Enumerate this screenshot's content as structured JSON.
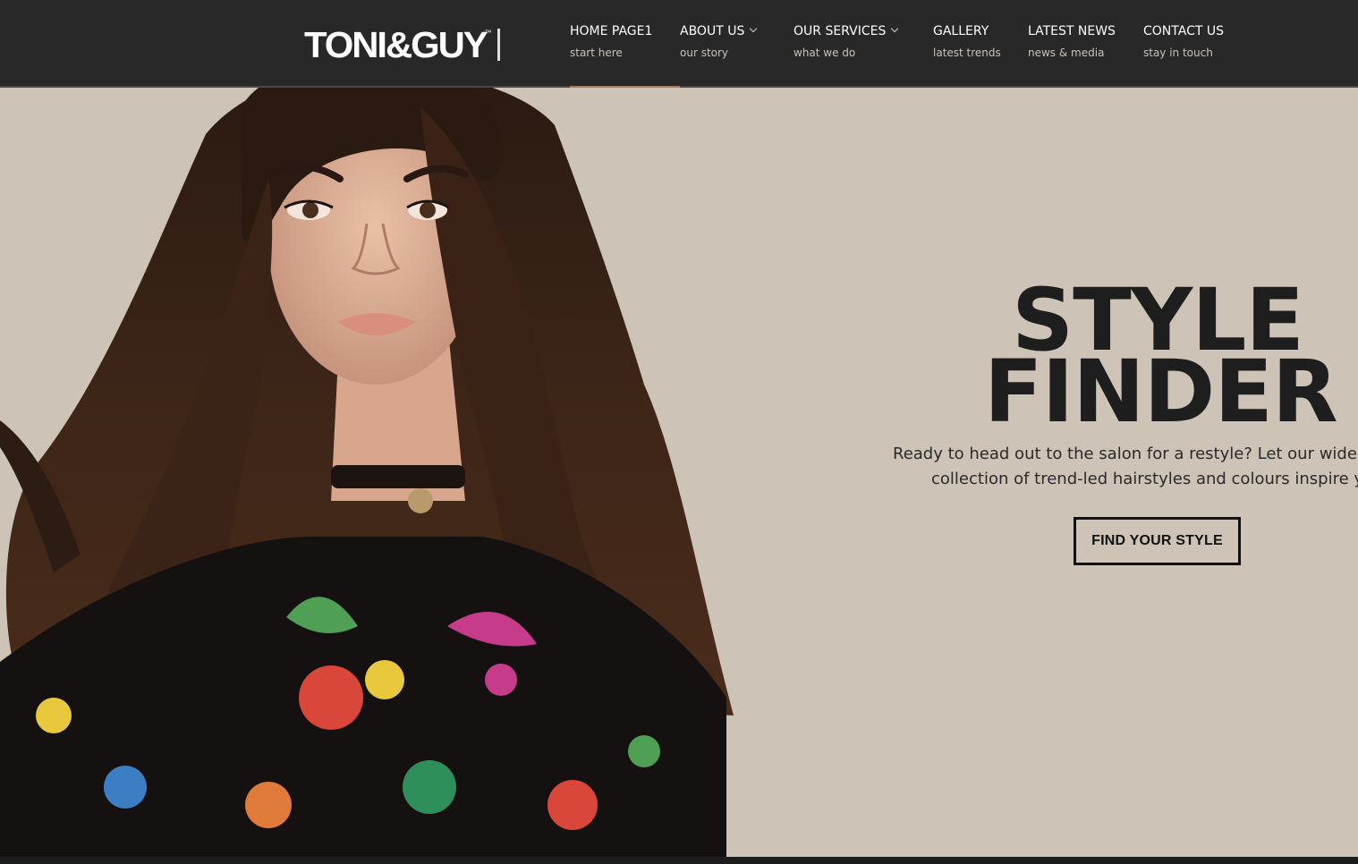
{
  "brand": {
    "logo_text": "TONI&GUY",
    "tm": "™"
  },
  "nav": {
    "items": [
      {
        "title": "HOME PAGE1",
        "sub": "start here",
        "dropdown": false,
        "active": true
      },
      {
        "title": "ABOUT US",
        "sub": "our story",
        "dropdown": true,
        "active": false
      },
      {
        "title": "OUR SERVICES",
        "sub": "what we do",
        "dropdown": true,
        "active": false
      },
      {
        "title": "GALLERY",
        "sub": "latest trends",
        "dropdown": false,
        "active": false
      },
      {
        "title": "LATEST NEWS",
        "sub": "news & media",
        "dropdown": false,
        "active": false
      },
      {
        "title": "CONTACT US",
        "sub": "stay in touch",
        "dropdown": false,
        "active": false
      }
    ]
  },
  "hero": {
    "headline_1": "STYLE",
    "headline_2": "FINDER",
    "text_line_1": "Ready to head out to the salon for a restyle? Let our wide",
    "text_line_2": "collection of trend-led hairstyles and colours inspire y",
    "cta_label": "FIND YOUR STYLE",
    "image": "hero-model-photo"
  },
  "colors": {
    "header_bg": "#282828",
    "hero_bg": "#cdc3b6",
    "accent_underline": "#a77a5c",
    "headline": "#1e1e1e"
  }
}
